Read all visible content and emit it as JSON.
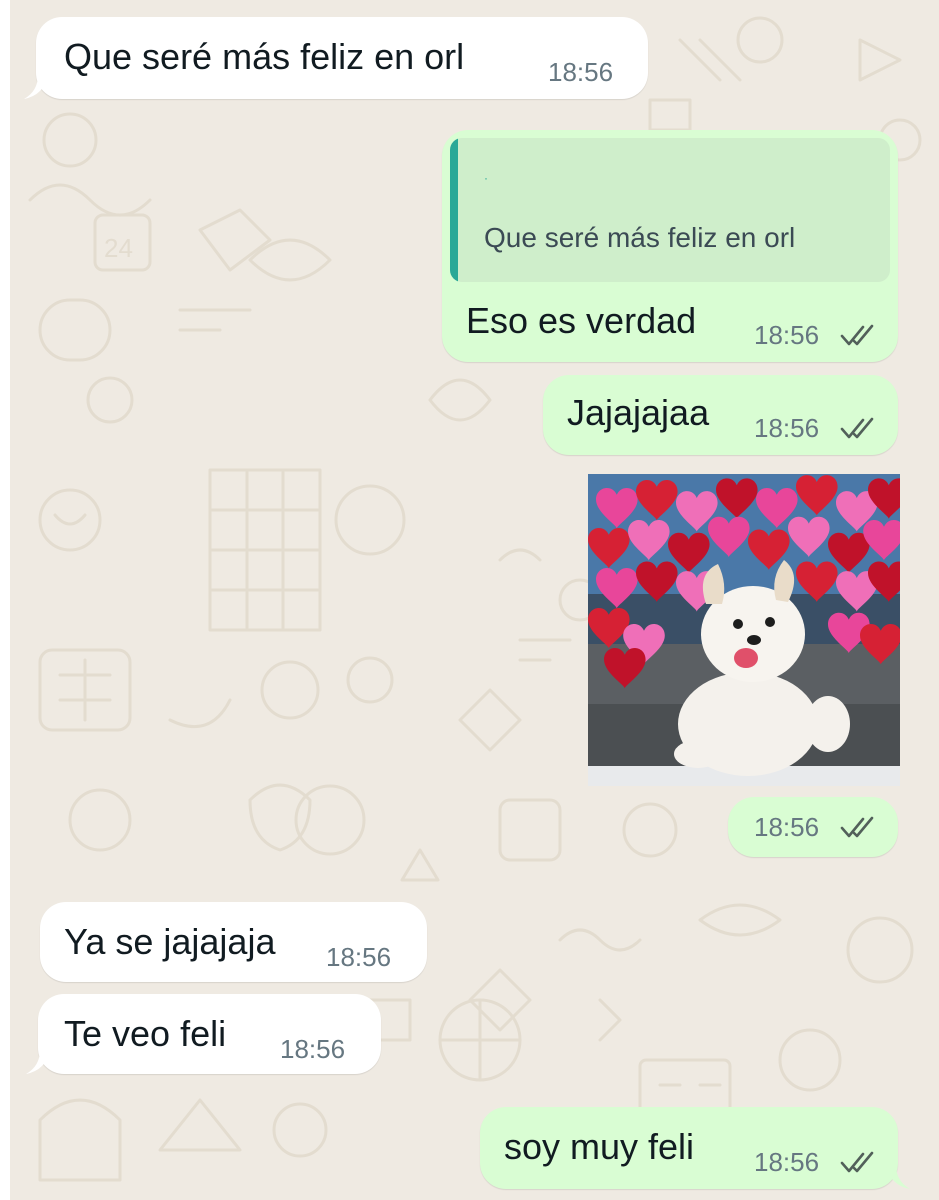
{
  "colors": {
    "background": "#efeae2",
    "incoming_bubble": "#ffffff",
    "outgoing_bubble": "#d9fdd3",
    "quote_bar": "#2aa897",
    "timestamp": "#667781",
    "read_ticks": "#52605a"
  },
  "messages": [
    {
      "direction": "incoming",
      "text": "Que seré más feliz en orl",
      "time": "18:56"
    },
    {
      "direction": "outgoing",
      "reply_to": {
        "sender": "·",
        "text": "Que seré más feliz en orl"
      },
      "text": "Eso es verdad",
      "time": "18:56",
      "status_icon": "double-check-read-icon"
    },
    {
      "direction": "outgoing",
      "text": "Jajajajaa",
      "time": "18:56",
      "status_icon": "double-check-read-icon"
    },
    {
      "direction": "outgoing",
      "type": "sticker",
      "sticker": "smiling-white-puppy-with-hearts",
      "time": "18:56",
      "status_icon": "double-check-read-icon"
    },
    {
      "direction": "incoming",
      "text": "Ya se jajajaja",
      "time": "18:56"
    },
    {
      "direction": "incoming",
      "text": "Te veo feli",
      "time": "18:56"
    },
    {
      "direction": "outgoing",
      "text": "soy muy feli",
      "time": "18:56",
      "status_icon": "double-check-read-icon"
    }
  ]
}
